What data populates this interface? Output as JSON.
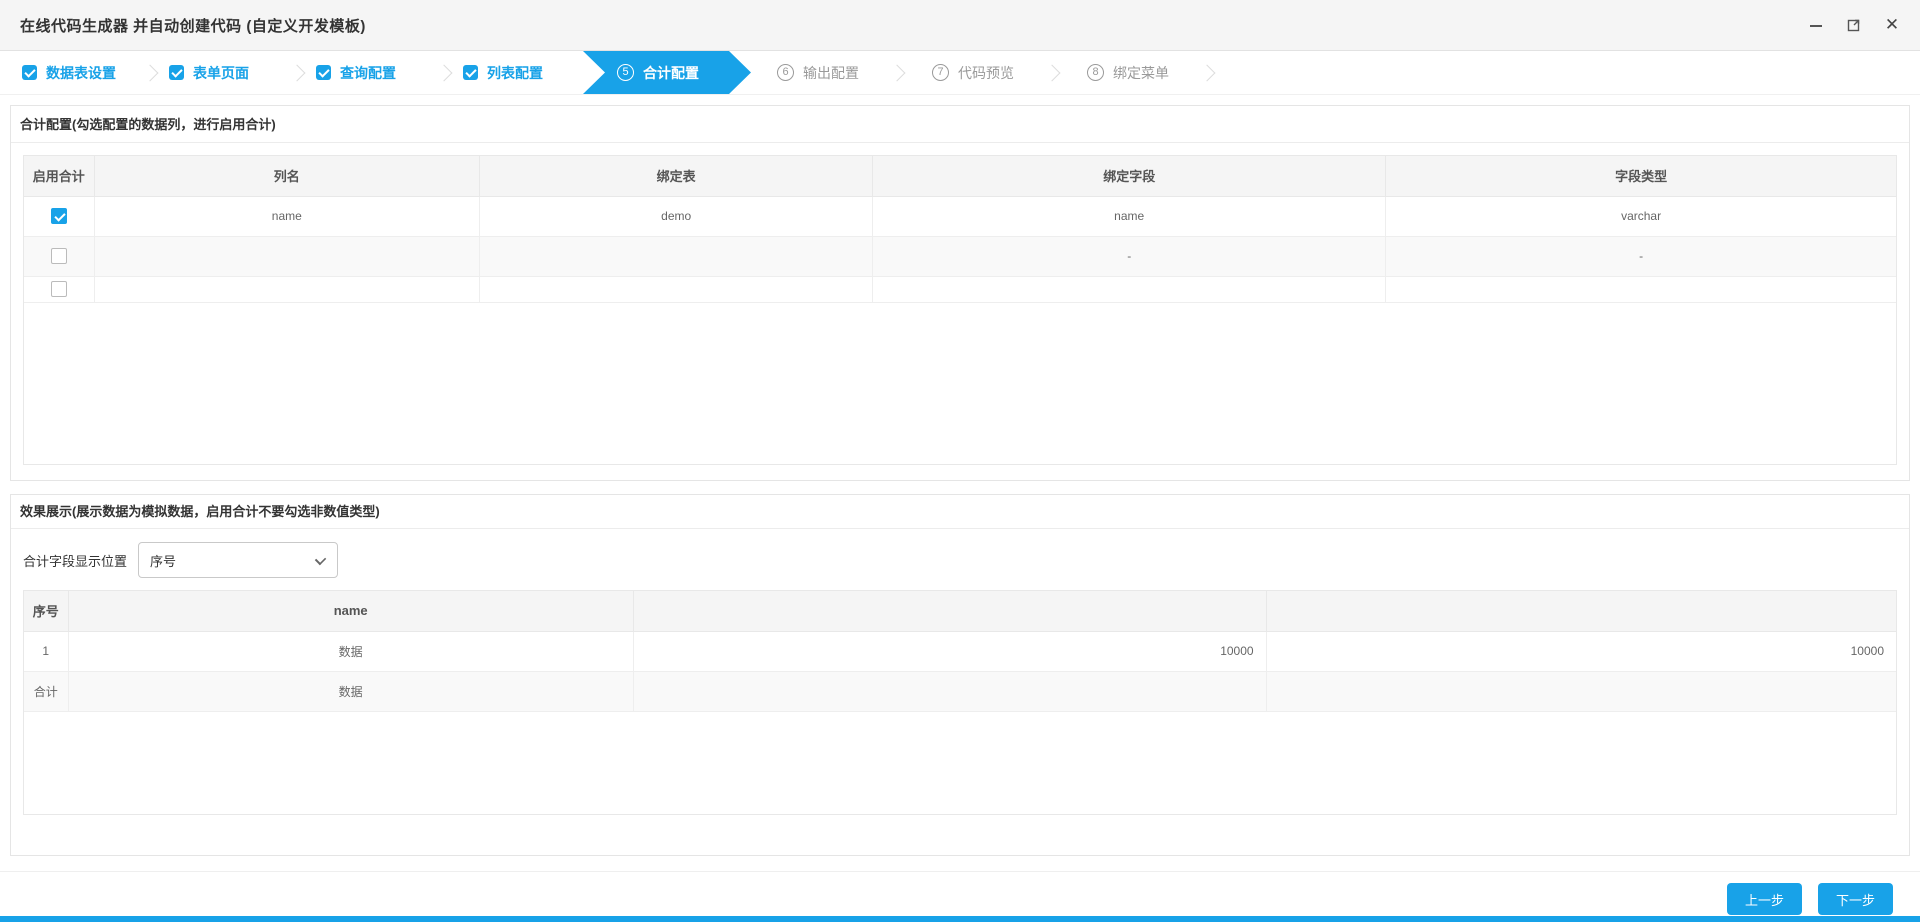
{
  "colors": {
    "accent": "#18a2e8"
  },
  "window": {
    "title": "在线代码生成器 并自动创建代码 (自定义开发模板)",
    "minimize": "minimize",
    "maximize": "maximize",
    "close": "×"
  },
  "steps": [
    {
      "label": "数据表设置",
      "state": "done"
    },
    {
      "label": "表单页面",
      "state": "done"
    },
    {
      "label": "查询配置",
      "state": "done"
    },
    {
      "label": "列表配置",
      "state": "done"
    },
    {
      "num": "5",
      "label": "合计配置",
      "state": "active"
    },
    {
      "num": "6",
      "label": "输出配置",
      "state": "todo"
    },
    {
      "num": "7",
      "label": "代码预览",
      "state": "todo"
    },
    {
      "num": "8",
      "label": "绑定菜单",
      "state": "todo"
    }
  ],
  "sum_config": {
    "title": "合计配置(勾选配置的数据列，进行启用合计)",
    "columns": {
      "enable": "启用合计",
      "col_name": "列名",
      "bind_table": "绑定表",
      "bind_field": "绑定字段",
      "field_type": "字段类型"
    },
    "rows": [
      {
        "checked": true,
        "col_name": "name",
        "bind_table": "demo",
        "bind_field": "name",
        "field_type": "varchar"
      },
      {
        "checked": false,
        "col_name": "",
        "bind_table": "",
        "bind_field": "-",
        "field_type": "-"
      },
      {
        "checked": false,
        "col_name": "",
        "bind_table": "",
        "bind_field": "",
        "field_type": ""
      }
    ]
  },
  "preview": {
    "title": "效果展示(展示数据为模拟数据，启用合计不要勾选非数值类型)",
    "position_label": "合计字段显示位置",
    "position_value": "序号",
    "columns": {
      "index": "序号",
      "name": "name",
      "c3": "",
      "c4": ""
    },
    "rows": [
      {
        "c0": "1",
        "c1": "数据",
        "c2": "10000",
        "c3": "10000"
      },
      {
        "c0": "合计",
        "c1": "数据",
        "c2": "",
        "c3": ""
      }
    ]
  },
  "footer": {
    "prev_label": "上一步",
    "next_label": "下一步"
  }
}
